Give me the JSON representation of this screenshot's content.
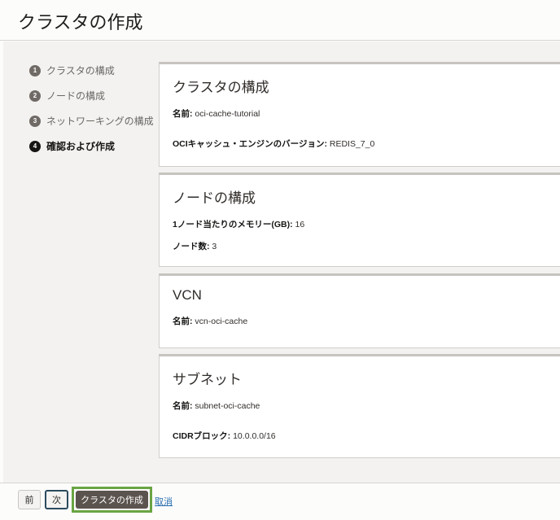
{
  "header": {
    "title": "クラスタの作成"
  },
  "steps": [
    {
      "num": "1",
      "label": "クラスタの構成"
    },
    {
      "num": "2",
      "label": "ノードの構成"
    },
    {
      "num": "3",
      "label": "ネットワーキングの構成"
    },
    {
      "num": "4",
      "label": "確認および作成",
      "active": true
    }
  ],
  "cards": [
    {
      "title": "クラスタの構成",
      "rows": [
        {
          "label": "名前:",
          "value": "oci-cache-tutorial"
        },
        {
          "label": "OCIキャッシュ・エンジンのバージョン:",
          "value": "REDIS_7_0"
        }
      ]
    },
    {
      "title": "ノードの構成",
      "rows": [
        {
          "label": "1ノード当たりのメモリー(GB):",
          "value": "16"
        },
        {
          "label": "ノード数:",
          "value": "3"
        }
      ]
    },
    {
      "title": "VCN",
      "rows": [
        {
          "label": "名前:",
          "value": "vcn-oci-cache"
        }
      ]
    },
    {
      "title": "サブネット",
      "rows": [
        {
          "label": "名前:",
          "value": "subnet-oci-cache"
        },
        {
          "label": "CIDRブロック:",
          "value": "10.0.0.0/16"
        }
      ]
    }
  ],
  "footer": {
    "prev": "前",
    "next": "次",
    "create": "クラスタの作成",
    "cancel": "取消",
    "highlight_color": "#6aa443"
  }
}
